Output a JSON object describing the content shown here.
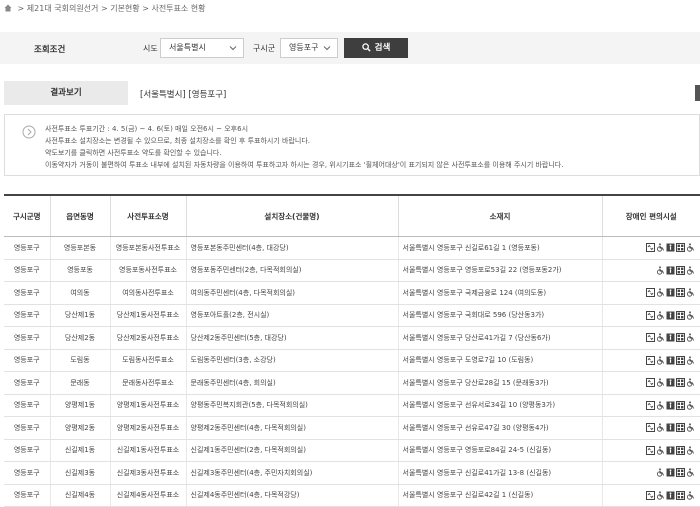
{
  "breadcrumb": [
    "제21대 국회의원선거",
    "기본현황",
    "사전투표소 현황"
  ],
  "breadcrumb_sep": ">",
  "search": {
    "section_label": "조회조건",
    "sido_label": "시도",
    "sido_value": "서울특별시",
    "gusigun_label": "구시군",
    "gusigun_value": "영등포구",
    "button_label": "검색"
  },
  "result": {
    "header": "결과보기",
    "value": "[서울특별시] [영등포구]"
  },
  "notice": {
    "lines": [
      "사전투표소 투표기간 : 4. 5(금) ~ 4. 6(토) 매일 오전6시 ~ 오후6시",
      "사전투표소 설치장소는 변경될 수 있으므로, 최종 설치장소를 확인 후 투표하시기 바랍니다.",
      "약도보기를 클릭하면 사전투표소 약도를 확인할 수 있습니다.",
      "이동약자가 거동이 불편하여 투표소 내부에 설치된 자동차량을 이용하여 투표하고자 하시는 경우, 위시기표소 '휠체어대상'이 표기되지 않은 사전투표소를 이용해 주시기 바랍니다."
    ]
  },
  "table": {
    "headers": [
      "구시군명",
      "읍면동명",
      "사전투표소명",
      "설치장소(건물명)",
      "소재지",
      "장애인 편의시설"
    ],
    "rows": [
      {
        "gu": "영등포구",
        "dong": "영등포본동",
        "name": "영등포본동사전투표소",
        "place": "영등포본동주민센터(4층, 대강당)",
        "addr": "서울특별시 영등포구 신길로61길 1 (영등포동)",
        "icons": [
          "elevator",
          "wheelchair",
          "accessible",
          "parking",
          "wheelchair"
        ]
      },
      {
        "gu": "영등포구",
        "dong": "영등포동",
        "name": "영등포동사전투표소",
        "place": "영등포동주민센터(2층, 다목적회의실)",
        "addr": "서울특별시 영등포구 영등포로53길 22 (영등포동2가)",
        "icons": [
          "wheelchair",
          "accessible",
          "parking",
          "wheelchair"
        ]
      },
      {
        "gu": "영등포구",
        "dong": "여의동",
        "name": "여의동사전투표소",
        "place": "여의동주민센터(4층, 다목적회의실)",
        "addr": "서울특별시 영등포구 국제금융로 124 (여의도동)",
        "icons": [
          "elevator",
          "wheelchair",
          "accessible",
          "parking",
          "wheelchair"
        ]
      },
      {
        "gu": "영등포구",
        "dong": "당산제1동",
        "name": "당산제1동사전투표소",
        "place": "영등포아트홀(2층, 전시실)",
        "addr": "서울특별시 영등포구 국회대로 596 (당산동3가)",
        "icons": [
          "elevator",
          "wheelchair",
          "accessible",
          "parking",
          "wheelchair"
        ]
      },
      {
        "gu": "영등포구",
        "dong": "당산제2동",
        "name": "당산제2동사전투표소",
        "place": "당산제2동주민센터(5층, 대강당)",
        "addr": "서울특별시 영등포구 당산로41가길 7 (당산동6가)",
        "icons": [
          "elevator",
          "wheelchair",
          "accessible",
          "parking",
          "wheelchair"
        ]
      },
      {
        "gu": "영등포구",
        "dong": "도림동",
        "name": "도림동사전투표소",
        "place": "도림동주민센터(3층, 소강당)",
        "addr": "서울특별시 영등포구 도영로7길 10 (도림동)",
        "icons": [
          "elevator",
          "wheelchair",
          "accessible",
          "parking",
          "wheelchair"
        ]
      },
      {
        "gu": "영등포구",
        "dong": "문래동",
        "name": "문래동사전투표소",
        "place": "문래동주민센터(4층, 회의실)",
        "addr": "서울특별시 영등포구 당산로28길 15 (문래동3가)",
        "icons": [
          "elevator",
          "wheelchair",
          "accessible",
          "parking",
          "wheelchair"
        ]
      },
      {
        "gu": "영등포구",
        "dong": "양평제1동",
        "name": "양평제1동사전투표소",
        "place": "양평동주민복지회관(5층, 다목적회의실)",
        "addr": "서울특별시 영등포구 선유서로34길 10 (양평동3가)",
        "icons": [
          "elevator",
          "wheelchair",
          "accessible",
          "parking",
          "wheelchair"
        ]
      },
      {
        "gu": "영등포구",
        "dong": "양평제2동",
        "name": "양평제2동사전투표소",
        "place": "양평제2동주민센터(4층, 다목적회의실)",
        "addr": "서울특별시 영등포구 선유로47길 30 (양평동4가)",
        "icons": [
          "elevator",
          "wheelchair",
          "accessible",
          "parking",
          "wheelchair"
        ]
      },
      {
        "gu": "영등포구",
        "dong": "신길제1동",
        "name": "신길제1동사전투표소",
        "place": "신길제1동주민센터(2층, 다목적회의실)",
        "addr": "서울특별시 영등포구 영등포로84길 24-5 (신길동)",
        "icons": [
          "elevator",
          "wheelchair",
          "accessible",
          "parking",
          "wheelchair"
        ]
      },
      {
        "gu": "영등포구",
        "dong": "신길제3동",
        "name": "신길제3동사전투표소",
        "place": "신길제3동주민센터(4층, 주민자치회의실)",
        "addr": "서울특별시 영등포구 신길로41가길 13-8 (신길동)",
        "icons": [
          "wheelchair",
          "accessible",
          "parking",
          "wheelchair"
        ]
      },
      {
        "gu": "영등포구",
        "dong": "신길제4동",
        "name": "신길제4동사전투표소",
        "place": "신길제4동주민센터(4층, 다목적강당)",
        "addr": "서울특별시 영등포구 신길로42길 1 (신길동)",
        "icons": [
          "elevator",
          "wheelchair",
          "accessible",
          "parking",
          "wheelchair"
        ]
      }
    ]
  }
}
